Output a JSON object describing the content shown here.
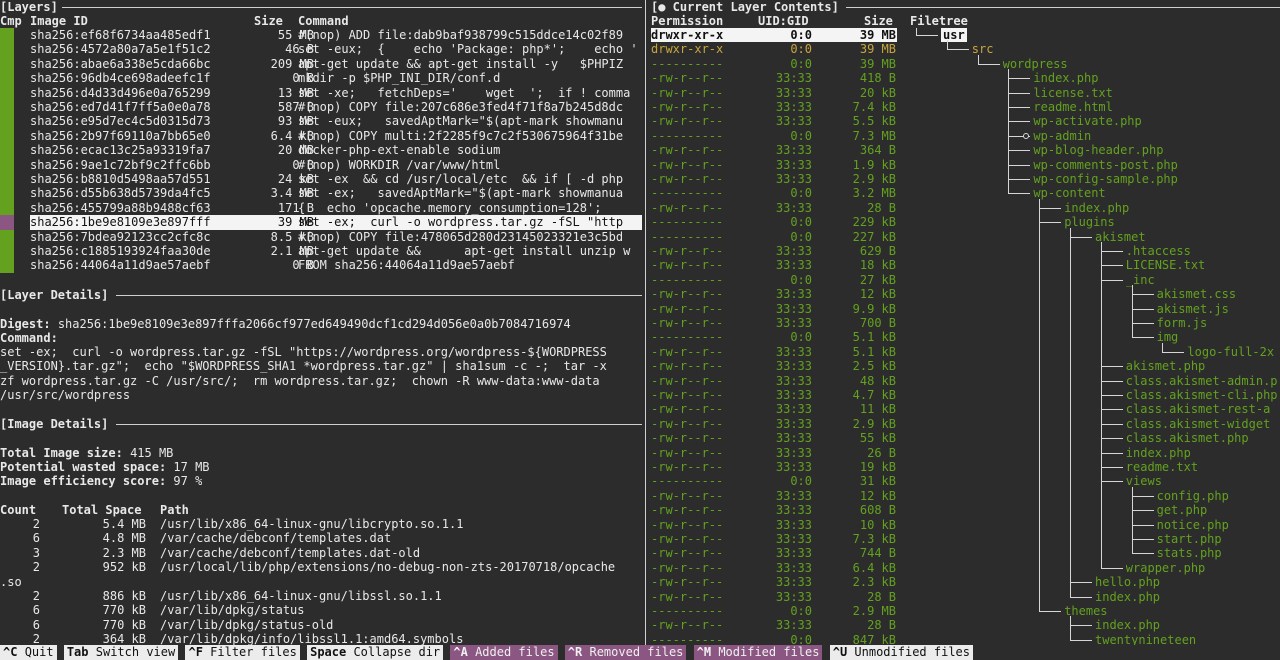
{
  "left": {
    "layers_title": "[Layers]",
    "layers_header": {
      "cmp": "Cmp",
      "image_id": "Image ID",
      "size": "Size",
      "command": "Command"
    },
    "layers": [
      {
        "id": "sha256:ef68f6734aa485edf1",
        "size": "55 MB",
        "cmd": "#(nop) ADD file:dab9baf938799c515ddce14c02f89"
      },
      {
        "id": "sha256:4572a80a7a5e1f51c2",
        "size": "46 B",
        "cmd": "set -eux;  {    echo 'Package: php*';    echo '"
      },
      {
        "id": "sha256:abae6a338e5cda66bc",
        "size": "209 MB",
        "cmd": "apt-get update && apt-get install -y   $PHPIZ"
      },
      {
        "id": "sha256:96db4ce698adeefc1f",
        "size": "0 B",
        "cmd": "mkdir -p $PHP_INI_DIR/conf.d"
      },
      {
        "id": "sha256:d4d33d496e0a765299",
        "size": "13 MB",
        "cmd": "set -xe;   fetchDeps='    wget  ';  if ! comma"
      },
      {
        "id": "sha256:ed7d41f7ff5a0e0a78",
        "size": "587 B",
        "cmd": "#(nop) COPY file:207c686e3fed4f71f8a7b245d8dc"
      },
      {
        "id": "sha256:e95d7ec4c5d0315d73",
        "size": "93 MB",
        "cmd": "set -eux;   savedAptMark=\"$(apt-mark showmanu"
      },
      {
        "id": "sha256:2b97f69110a7bb65e0",
        "size": "6.4 kB",
        "cmd": "#(nop) COPY multi:2f2285f9c7c2f530675964f31be"
      },
      {
        "id": "sha256:ecac13c25a93319fa7",
        "size": "20 MB",
        "cmd": "docker-php-ext-enable sodium"
      },
      {
        "id": "sha256:9ae1c72bf9c2ffc6bb",
        "size": "0 B",
        "cmd": "#(nop) WORKDIR /var/www/html"
      },
      {
        "id": "sha256:b8810d5498aa57d551",
        "size": "24 kB",
        "cmd": "set -ex  && cd /usr/local/etc  && if [ -d php"
      },
      {
        "id": "sha256:d55b638d5739da4fc5",
        "size": "3.4 MB",
        "cmd": "set -ex;   savedAptMark=\"$(apt-mark showmanua"
      },
      {
        "id": "sha256:455799a88b9488cf63",
        "size": "171 B",
        "cmd": "{   echo 'opcache.memory_consumption=128';"
      },
      {
        "id": "sha256:1be9e8109e3e897fff",
        "size": "39 MB",
        "cmd": "set -ex;  curl -o wordpress.tar.gz -fSL \"http"
      },
      {
        "id": "sha256:7bdea92123cc2cfc8c",
        "size": "8.5 kB",
        "cmd": "#(nop) COPY file:478065d280d23145023321e3c5bd"
      },
      {
        "id": "sha256:c1885193924faa30de",
        "size": "2.1 MB",
        "cmd": "apt-get update &&      apt-get install unzip w"
      },
      {
        "id": "sha256:44064a11d9ae57aebf",
        "size": "0 B",
        "cmd": "FROM sha256:44064a11d9ae57aebf"
      }
    ],
    "layer_details_title": "[Layer Details]",
    "digest_label": "Digest:",
    "digest_value": "sha256:1be9e8109e3e897fffa2066cf977ed649490dcf1cd294d056e0a0b7084716974",
    "command_label": "Command:",
    "command_lines": [
      "set -ex;  curl -o wordpress.tar.gz -fSL \"https://wordpress.org/wordpress-${WORDPRESS",
      "_VERSION}.tar.gz\";  echo \"$WORDPRESS_SHA1 *wordpress.tar.gz\" | sha1sum -c -;  tar -x",
      "zf wordpress.tar.gz -C /usr/src/;  rm wordpress.tar.gz;  chown -R www-data:www-data",
      "/usr/src/wordpress"
    ],
    "image_details_title": "[Image Details]",
    "total_size_label": "Total Image size:",
    "total_size": "415 MB",
    "wasted_label": "Potential wasted space:",
    "wasted": "17 MB",
    "efficiency_label": "Image efficiency score:",
    "efficiency": "97 %",
    "waste_header": {
      "count": "Count",
      "total": "Total Space",
      "path": "Path"
    },
    "waste_rows": [
      {
        "count": "2",
        "space": "5.4 MB",
        "path": "/usr/lib/x86_64-linux-gnu/libcrypto.so.1.1"
      },
      {
        "count": "6",
        "space": "4.8 MB",
        "path": "/var/cache/debconf/templates.dat"
      },
      {
        "count": "3",
        "space": "2.3 MB",
        "path": "/var/cache/debconf/templates.dat-old"
      },
      {
        "count": "2",
        "space": "952 kB",
        "path": "/usr/local/lib/php/extensions/no-debug-non-zts-20170718/opcache"
      },
      {
        "count": "",
        "space": "",
        "path": ".so",
        "wrap": true
      },
      {
        "count": "2",
        "space": "886 kB",
        "path": "/usr/lib/x86_64-linux-gnu/libssl.so.1.1"
      },
      {
        "count": "6",
        "space": "770 kB",
        "path": "/var/lib/dpkg/status"
      },
      {
        "count": "6",
        "space": "770 kB",
        "path": "/var/lib/dpkg/status-old"
      },
      {
        "count": "2",
        "space": "364 kB",
        "path": "/var/lib/dpkg/info/libssl1.1:amd64.symbols"
      }
    ]
  },
  "right": {
    "title": "[● Current Layer Contents]",
    "header": {
      "perm": "Permission",
      "uidgid": "UID:GID",
      "size": "Size",
      "tree": "Filetree"
    },
    "files": [
      {
        "perm": "drwxr-xr-x",
        "uid": "0:0",
        "size": "39 MB",
        "name": "usr",
        "depth": 0,
        "style": "sel"
      },
      {
        "perm": "drwxr-xr-x",
        "uid": "0:0",
        "size": "39 MB",
        "name": "src",
        "depth": 1,
        "style": "orange"
      },
      {
        "perm": "----------",
        "uid": "0:0",
        "size": "39 MB",
        "name": "wordpress",
        "depth": 2
      },
      {
        "perm": "-rw-r--r--",
        "uid": "33:33",
        "size": "418 B",
        "name": "index.php",
        "depth": 3
      },
      {
        "perm": "-rw-r--r--",
        "uid": "33:33",
        "size": "20 kB",
        "name": "license.txt",
        "depth": 3
      },
      {
        "perm": "-rw-r--r--",
        "uid": "33:33",
        "size": "7.4 kB",
        "name": "readme.html",
        "depth": 3
      },
      {
        "perm": "-rw-r--r--",
        "uid": "33:33",
        "size": "5.5 kB",
        "name": "wp-activate.php",
        "depth": 3
      },
      {
        "perm": "----------",
        "uid": "0:0",
        "size": "7.3 MB",
        "name": "wp-admin",
        "depth": 3,
        "collapsed": true
      },
      {
        "perm": "-rw-r--r--",
        "uid": "33:33",
        "size": "364 B",
        "name": "wp-blog-header.php",
        "depth": 3
      },
      {
        "perm": "-rw-r--r--",
        "uid": "33:33",
        "size": "1.9 kB",
        "name": "wp-comments-post.php",
        "depth": 3
      },
      {
        "perm": "-rw-r--r--",
        "uid": "33:33",
        "size": "2.9 kB",
        "name": "wp-config-sample.php",
        "depth": 3
      },
      {
        "perm": "----------",
        "uid": "0:0",
        "size": "3.2 MB",
        "name": "wp-content",
        "depth": 3
      },
      {
        "perm": "-rw-r--r--",
        "uid": "33:33",
        "size": "28 B",
        "name": "index.php",
        "depth": 4
      },
      {
        "perm": "----------",
        "uid": "0:0",
        "size": "229 kB",
        "name": "plugins",
        "depth": 4
      },
      {
        "perm": "----------",
        "uid": "0:0",
        "size": "227 kB",
        "name": "akismet",
        "depth": 5
      },
      {
        "perm": "-rw-r--r--",
        "uid": "33:33",
        "size": "629 B",
        "name": ".htaccess",
        "depth": 6
      },
      {
        "perm": "-rw-r--r--",
        "uid": "33:33",
        "size": "18 kB",
        "name": "LICENSE.txt",
        "depth": 6
      },
      {
        "perm": "----------",
        "uid": "0:0",
        "size": "27 kB",
        "name": "_inc",
        "depth": 6
      },
      {
        "perm": "-rw-r--r--",
        "uid": "33:33",
        "size": "12 kB",
        "name": "akismet.css",
        "depth": 7
      },
      {
        "perm": "-rw-r--r--",
        "uid": "33:33",
        "size": "9.9 kB",
        "name": "akismet.js",
        "depth": 7
      },
      {
        "perm": "-rw-r--r--",
        "uid": "33:33",
        "size": "700 B",
        "name": "form.js",
        "depth": 7
      },
      {
        "perm": "----------",
        "uid": "0:0",
        "size": "5.1 kB",
        "name": "img",
        "depth": 7
      },
      {
        "perm": "-rw-r--r--",
        "uid": "33:33",
        "size": "5.1 kB",
        "name": "logo-full-2x",
        "depth": 8
      },
      {
        "perm": "-rw-r--r--",
        "uid": "33:33",
        "size": "2.5 kB",
        "name": "akismet.php",
        "depth": 6
      },
      {
        "perm": "-rw-r--r--",
        "uid": "33:33",
        "size": "48 kB",
        "name": "class.akismet-admin.p",
        "depth": 6
      },
      {
        "perm": "-rw-r--r--",
        "uid": "33:33",
        "size": "4.7 kB",
        "name": "class.akismet-cli.php",
        "depth": 6
      },
      {
        "perm": "-rw-r--r--",
        "uid": "33:33",
        "size": "11 kB",
        "name": "class.akismet-rest-a",
        "depth": 6
      },
      {
        "perm": "-rw-r--r--",
        "uid": "33:33",
        "size": "2.9 kB",
        "name": "class.akismet-widget",
        "depth": 6
      },
      {
        "perm": "-rw-r--r--",
        "uid": "33:33",
        "size": "55 kB",
        "name": "class.akismet.php",
        "depth": 6
      },
      {
        "perm": "-rw-r--r--",
        "uid": "33:33",
        "size": "26 B",
        "name": "index.php",
        "depth": 6
      },
      {
        "perm": "-rw-r--r--",
        "uid": "33:33",
        "size": "19 kB",
        "name": "readme.txt",
        "depth": 6
      },
      {
        "perm": "----------",
        "uid": "0:0",
        "size": "31 kB",
        "name": "views",
        "depth": 6
      },
      {
        "perm": "-rw-r--r--",
        "uid": "33:33",
        "size": "12 kB",
        "name": "config.php",
        "depth": 7
      },
      {
        "perm": "-rw-r--r--",
        "uid": "33:33",
        "size": "608 B",
        "name": "get.php",
        "depth": 7
      },
      {
        "perm": "-rw-r--r--",
        "uid": "33:33",
        "size": "10 kB",
        "name": "notice.php",
        "depth": 7
      },
      {
        "perm": "-rw-r--r--",
        "uid": "33:33",
        "size": "7.3 kB",
        "name": "start.php",
        "depth": 7
      },
      {
        "perm": "-rw-r--r--",
        "uid": "33:33",
        "size": "744 B",
        "name": "stats.php",
        "depth": 7
      },
      {
        "perm": "-rw-r--r--",
        "uid": "33:33",
        "size": "6.4 kB",
        "name": "wrapper.php",
        "depth": 6
      },
      {
        "perm": "-rw-r--r--",
        "uid": "33:33",
        "size": "2.3 kB",
        "name": "hello.php",
        "depth": 5
      },
      {
        "perm": "-rw-r--r--",
        "uid": "33:33",
        "size": "28 B",
        "name": "index.php",
        "depth": 5
      },
      {
        "perm": "----------",
        "uid": "0:0",
        "size": "2.9 MB",
        "name": "themes",
        "depth": 4
      },
      {
        "perm": "-rw-r--r--",
        "uid": "33:33",
        "size": "28 B",
        "name": "index.php",
        "depth": 5
      },
      {
        "perm": "----------",
        "uid": "0:0",
        "size": "847 kB",
        "name": "twentynineteen",
        "depth": 5
      }
    ]
  },
  "footer": {
    "items": [
      {
        "key": "^C",
        "label": "Quit",
        "style": "white"
      },
      {
        "key": "Tab",
        "label": "Switch view",
        "style": "white"
      },
      {
        "key": "^F",
        "label": "Filter files",
        "style": "white"
      },
      {
        "key": "Space",
        "label": "Collapse dir",
        "style": "white"
      },
      {
        "key": "^A",
        "label": "Added files",
        "style": "purple"
      },
      {
        "key": "^R",
        "label": "Removed files",
        "style": "purple"
      },
      {
        "key": "^M",
        "label": "Modified files",
        "style": "purple"
      },
      {
        "key": "^U",
        "label": "Unmodified files",
        "style": "white"
      }
    ]
  },
  "colors": {
    "green": "#63a11f",
    "orange": "#c8a53c",
    "purple": "#8c5683",
    "bg": "#2c2c2c"
  }
}
